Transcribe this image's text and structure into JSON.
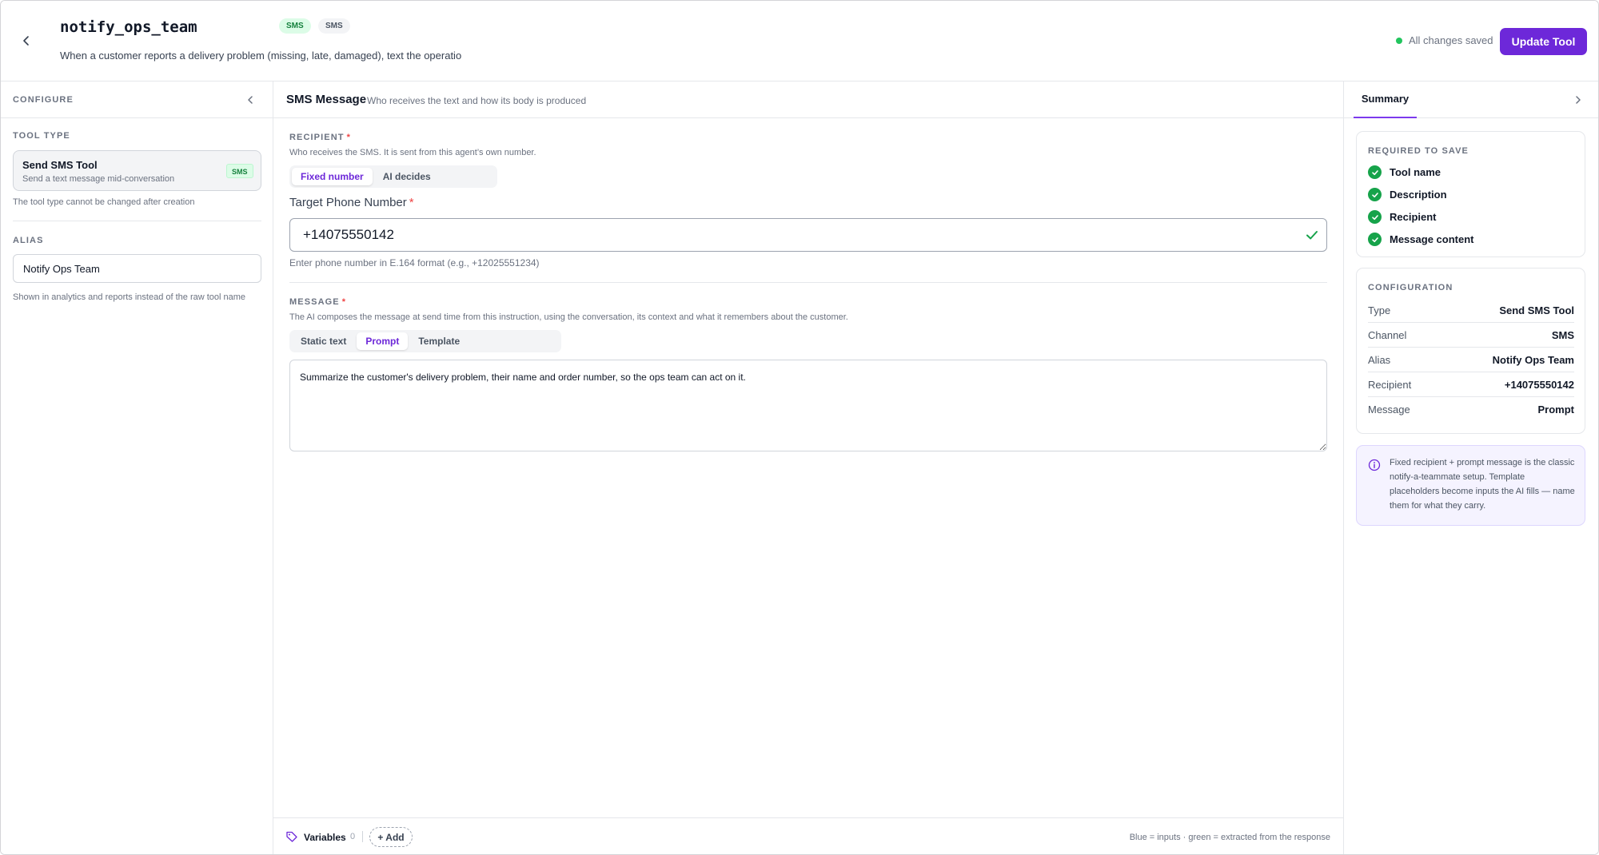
{
  "header": {
    "tool_name": "notify_ops_team",
    "badges": [
      "SMS",
      "SMS"
    ],
    "description": "When a customer reports a delivery problem (missing, late, damaged), text the operatio",
    "save_status": "All changes saved",
    "update_button": "Update Tool"
  },
  "left": {
    "title": "CONFIGURE",
    "tool_type_label": "TOOL TYPE",
    "tool_type": {
      "title": "Send SMS Tool",
      "subtitle": "Send a text message mid-conversation",
      "badge": "SMS"
    },
    "tool_type_note": "The tool type cannot be changed after creation",
    "alias_label": "ALIAS",
    "alias_value": "Notify Ops Team",
    "alias_note": "Shown in analytics and reports instead of the raw tool name"
  },
  "main": {
    "title": "SMS Message",
    "subtitle": "Who receives the text and how its body is produced",
    "recipient": {
      "label": "RECIPIENT",
      "required": "*",
      "help": "Who receives the SMS. It is sent from this agent’s own number.",
      "modes": [
        "Fixed number",
        "AI decides"
      ],
      "selected_mode": "Fixed number",
      "field_label": "Target Phone Number",
      "phone_value": "+14075550142",
      "phone_help": "Enter phone number in E.164 format (e.g., +12025551234)"
    },
    "message": {
      "label": "MESSAGE",
      "required": "*",
      "help": "The AI composes the message at send time from this instruction, using the conversation, its context and what it remembers about the customer.",
      "modes": [
        "Static text",
        "Prompt",
        "Template"
      ],
      "selected_mode": "Prompt",
      "value": "Summarize the customer's delivery problem, their name and order number, so the ops team can act on it."
    },
    "footer": {
      "variables_label": "Variables",
      "variables_count": "0",
      "add_button": "+ Add",
      "legend": "Blue = inputs · green = extracted from the response"
    }
  },
  "right": {
    "tab": "Summary",
    "required_title": "REQUIRED TO SAVE",
    "required_items": [
      "Tool name",
      "Description",
      "Recipient",
      "Message content"
    ],
    "config_title": "CONFIGURATION",
    "config_rows": [
      {
        "key": "Type",
        "value": "Send SMS Tool"
      },
      {
        "key": "Channel",
        "value": "SMS"
      },
      {
        "key": "Alias",
        "value": "Notify Ops Team"
      },
      {
        "key": "Recipient",
        "value": "+14075550142"
      },
      {
        "key": "Message",
        "value": "Prompt"
      }
    ],
    "info": "Fixed recipient + prompt message is the classic notify-a-teammate setup. Template placeholders become inputs the AI fills — name them for what they carry."
  },
  "colors": {
    "accent": "#6d28d9",
    "success": "#16a34a",
    "saved_dot": "#22c55e",
    "required": "#ef4444"
  },
  "icons": {
    "back": "chevron-left-icon",
    "collapse": "chevron-left-icon",
    "expand": "chevron-right-icon",
    "phone_valid": "check-icon",
    "variables": "tag-icon",
    "info": "info-icon"
  }
}
